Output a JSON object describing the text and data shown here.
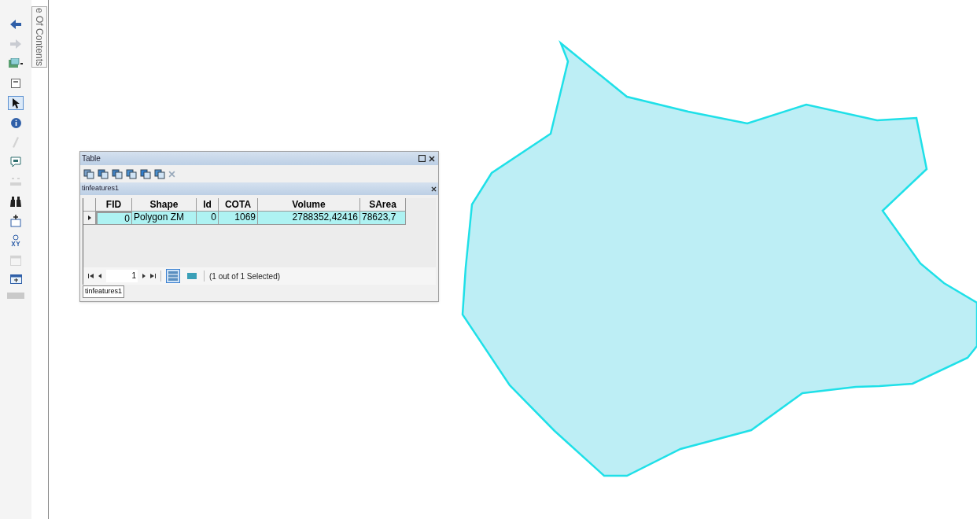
{
  "toc_tab": {
    "label": "e Of Contents"
  },
  "tools": [
    {
      "kind": "back",
      "selected": false,
      "disabled": false
    },
    {
      "kind": "forward",
      "selected": false,
      "disabled": true
    },
    {
      "kind": "layers",
      "selected": false,
      "disabled": false
    },
    {
      "kind": "page",
      "selected": false,
      "disabled": false
    },
    {
      "kind": "pointer",
      "selected": true,
      "disabled": false
    },
    {
      "kind": "info",
      "selected": false,
      "disabled": false
    },
    {
      "kind": "pencil",
      "selected": false,
      "disabled": true
    },
    {
      "kind": "callout",
      "selected": false,
      "disabled": false
    },
    {
      "kind": "grid",
      "selected": false,
      "disabled": true
    },
    {
      "kind": "binoculars",
      "selected": false,
      "disabled": false
    },
    {
      "kind": "hyperlink",
      "selected": false,
      "disabled": false
    },
    {
      "kind": "xy",
      "selected": false,
      "disabled": false
    },
    {
      "kind": "window",
      "selected": false,
      "disabled": true
    },
    {
      "kind": "viewer",
      "selected": false,
      "disabled": false
    }
  ],
  "table_window": {
    "title": "Table",
    "layer_title": "tinfeatures1",
    "columns": [
      "FID",
      "Shape",
      "Id",
      "COTA",
      "Volume",
      "SArea"
    ],
    "rows": [
      {
        "selected": true,
        "cells": [
          "0",
          "Polygon ZM",
          "0",
          "1069",
          "2788352,42416",
          "78623,7"
        ]
      }
    ],
    "record": "1",
    "views": [
      {
        "kind": "all",
        "selected": true
      },
      {
        "kind": "selected",
        "selected": false
      }
    ],
    "status": "(1 out of 1 Selected)",
    "tabs": [
      {
        "label": "tinfeatures1",
        "selected": true
      }
    ]
  }
}
